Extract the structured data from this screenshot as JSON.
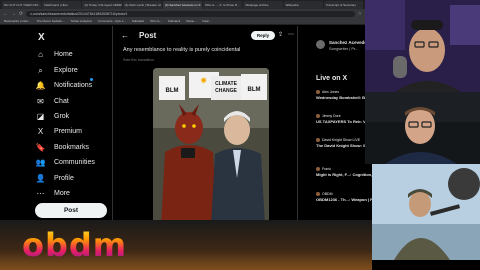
{
  "browser": {
    "tabs": [
      "NO CUT CUT THEM OFF - YouTube",
      "Dashboard | Uber",
      "(2) Today: ICE Agent ARRESTS...",
      "(2) Zach Lamb | Breaker of...",
      "(2) Sanchez Acevedo on X: Taking...",
      "Who is... - X: Is Photo R...",
      "Webpage archive",
      "Wikipedia",
      "Transcript of Secretary"
    ],
    "active_tab_index": 4,
    "url": "x.com/sanchezacevedo/status/2014476411892638716/photo/1",
    "bookmarks": [
      "Bookmarks | Liber...",
      "The Munro Sedatio...",
      "Twitter Analytics",
      "Comments - Kyle s...",
      "Substack",
      "Who is...",
      "Substack",
      "Diane...",
      "Dear..."
    ]
  },
  "sidebar": {
    "logo": "X",
    "items": [
      {
        "label": "Home",
        "icon": "home-icon",
        "glyph": "⌂"
      },
      {
        "label": "Explore",
        "icon": "search-icon",
        "glyph": "⌕"
      },
      {
        "label": "Notifications",
        "icon": "bell-icon",
        "glyph": "🔔"
      },
      {
        "label": "Chat",
        "icon": "mail-icon",
        "glyph": "✉"
      },
      {
        "label": "Grok",
        "icon": "grok-icon",
        "glyph": "◪"
      },
      {
        "label": "Premium",
        "icon": "x-premium-icon",
        "glyph": "X"
      },
      {
        "label": "Bookmarks",
        "icon": "bookmark-icon",
        "glyph": "🔖"
      },
      {
        "label": "Communities",
        "icon": "communities-icon",
        "glyph": "👥"
      },
      {
        "label": "Profile",
        "icon": "person-icon",
        "glyph": "👤"
      },
      {
        "label": "More",
        "icon": "more-icon",
        "glyph": "⋯"
      }
    ],
    "post_button": "Post"
  },
  "main": {
    "title": "Post",
    "reply_button": "Reply",
    "post_text": "Any resemblance to reality is purely coincidental",
    "translate_line": "Rate this translation",
    "image_signs": [
      "BLM",
      "CLIMATE CHANGE",
      "BLM"
    ]
  },
  "right": {
    "profile_name": "Sanchez Acevedo",
    "profile_bio": "Songwriter | Pr...",
    "live_title": "Live on X",
    "live_items": [
      {
        "author": "Alex Jones",
        "headline": "Wednesday Bombshell: Broadcast: Trump Pre..."
      },
      {
        "author": "Jimmy Dore",
        "headline": "US TAXPAYERS To Reb: Venezuelan Oil Industry..."
      },
      {
        "author": "David Knight Show LIVE",
        "headline": "The David Knight Show: 01/14/2026"
      },
      {
        "author": "Frank",
        "headline": "Might is Right, F...: Cognition, Open..."
      },
      {
        "author": "OBDM",
        "headline": "OBDM1236 - Th...: Weapon | Penta..."
      }
    ]
  },
  "overlay": {
    "brand": "obdm"
  },
  "colors": {
    "accent": "#1d9bf0",
    "live": "#f91880",
    "background": "#000000"
  }
}
